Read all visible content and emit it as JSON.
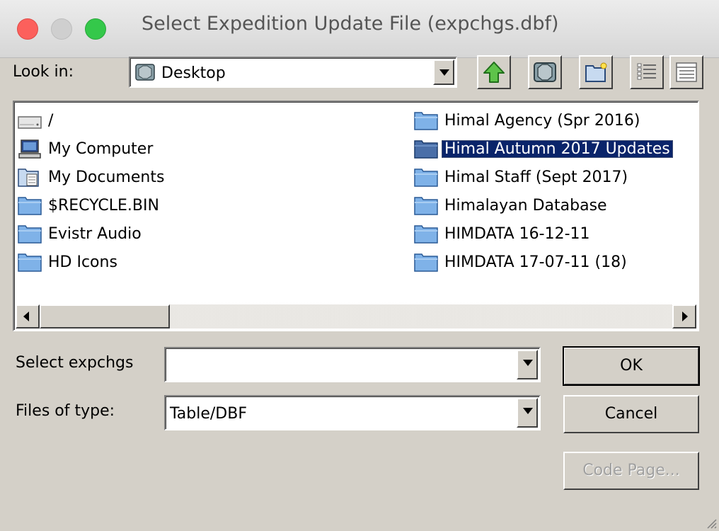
{
  "window": {
    "title": "Select Expedition Update File (expchgs.dbf)"
  },
  "lookin": {
    "label": "Look in:",
    "value": "Desktop"
  },
  "toolbar": {
    "icons": [
      "up-folder-icon",
      "desktop-icon",
      "new-folder-icon",
      "list-view-icon",
      "details-view-icon"
    ]
  },
  "files": {
    "left": [
      {
        "label": "/",
        "icon": "drive-icon"
      },
      {
        "label": "My Computer",
        "icon": "computer-icon"
      },
      {
        "label": "My Documents",
        "icon": "documents-folder-icon"
      },
      {
        "label": "$RECYCLE.BIN",
        "icon": "folder-icon"
      },
      {
        "label": "Evistr Audio",
        "icon": "folder-icon"
      },
      {
        "label": "HD Icons",
        "icon": "folder-icon"
      }
    ],
    "right": [
      {
        "label": "Himal Agency (Spr 2016)",
        "icon": "folder-icon"
      },
      {
        "label": "Himal Autumn 2017 Updates",
        "icon": "folder-icon",
        "selected": true
      },
      {
        "label": "Himal Staff (Sept 2017)",
        "icon": "folder-icon"
      },
      {
        "label": "Himalayan Database",
        "icon": "folder-icon"
      },
      {
        "label": "HIMDATA 16-12-11",
        "icon": "folder-icon"
      },
      {
        "label": "HIMDATA 17-07-11 (18)",
        "icon": "folder-icon"
      }
    ]
  },
  "form": {
    "select_label": "Select expchgs",
    "select_value": "",
    "type_label": "Files of type:",
    "type_value": "Table/DBF"
  },
  "buttons": {
    "ok": "OK",
    "cancel": "Cancel",
    "codepage": "Code Page..."
  },
  "colors": {
    "selection": "#0a246a",
    "dialog_bg": "#d4d0c8",
    "close": "#fc605c",
    "maximize": "#34c84a"
  }
}
